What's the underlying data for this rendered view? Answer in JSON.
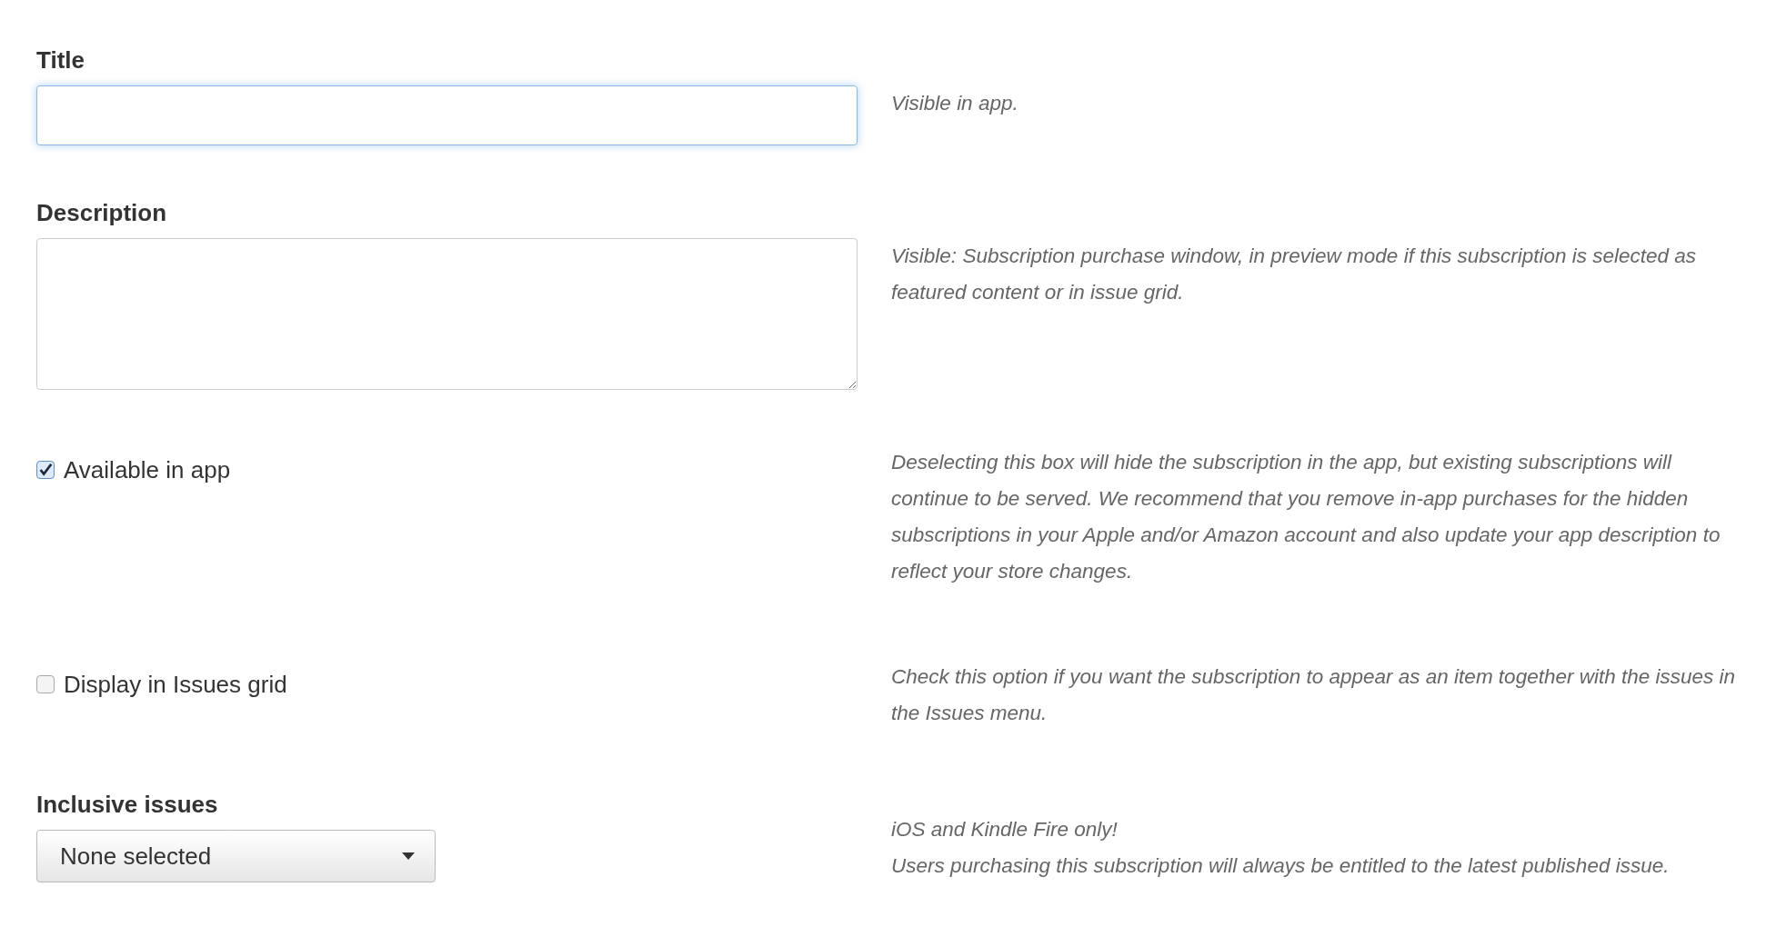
{
  "fields": [
    {
      "kind": "text",
      "label": "Title",
      "focused": true,
      "help": [
        "Visible in app."
      ]
    },
    {
      "kind": "textarea",
      "label": "Description",
      "focused": false,
      "help": [
        "Visible: Subscription purchase window, in preview mode if this subscription is selected as featured content or in issue grid."
      ]
    },
    {
      "kind": "checkbox",
      "label": "Available in app",
      "checked": true,
      "help": [
        "Deselecting this box will hide the subscription in the app, but existing subscriptions will continue to be served. We recommend that you remove in-app purchases for the hidden subscriptions in your Apple and/or Amazon account and also update your app description to reflect your store changes."
      ]
    },
    {
      "kind": "checkbox",
      "label": "Display in Issues grid",
      "checked": false,
      "help": [
        "Check this option if you want the subscription to appear as an item together with the issues in the Issues menu."
      ]
    },
    {
      "kind": "select",
      "label": "Inclusive issues",
      "value": "None selected",
      "help": [
        "iOS and Kindle Fire only!",
        "Users purchasing this subscription will always be entitled to the latest published issue."
      ]
    }
  ]
}
